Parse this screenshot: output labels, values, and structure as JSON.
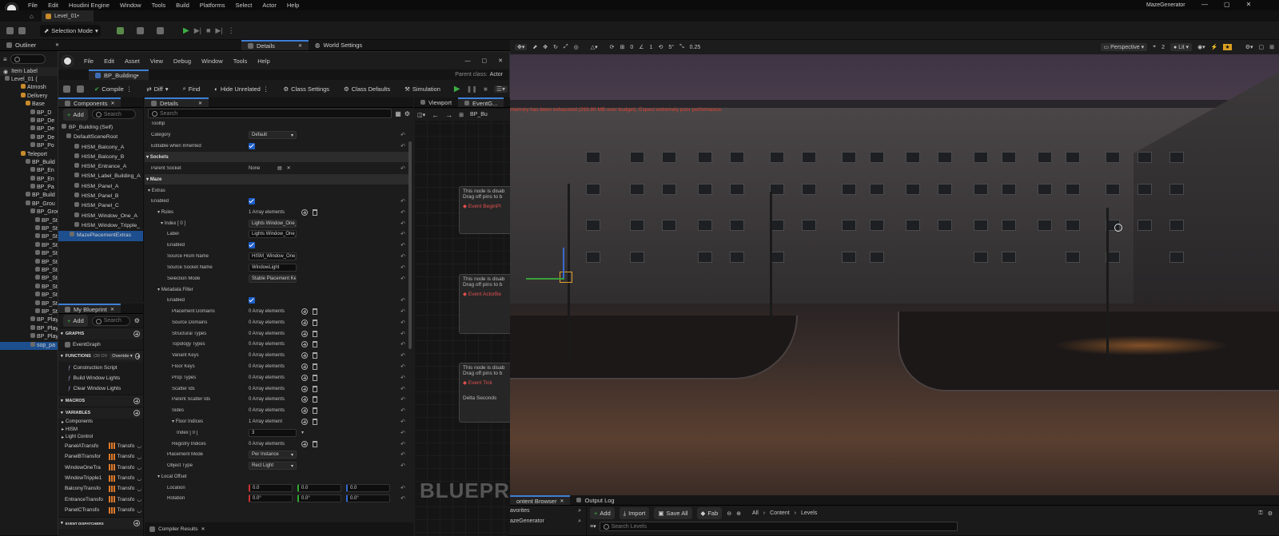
{
  "menubar": {
    "items": [
      "File",
      "Edit",
      "Houdini Engine",
      "Window",
      "Tools",
      "Build",
      "Platforms",
      "Select",
      "Actor",
      "Help"
    ],
    "project": "MazeGenerator"
  },
  "level_tab": "Level_01•",
  "toolbar": {
    "mode": "Selection Mode"
  },
  "left_tabs": {
    "outliner": "Outliner",
    "details": "Details",
    "world_settings": "World Settings"
  },
  "outliner": {
    "column": "Item Label",
    "items": [
      "Level_01 (",
      "Atmosh",
      "Delivery",
      "Base",
      "BP_D",
      "BP_De",
      "BP_De",
      "BP_De",
      "BP_Po",
      "Teleport",
      "BP_Build",
      "BP_En",
      "BP_En",
      "BP_Pa",
      "BP_Build",
      "BP_Grou",
      "BP_Grou",
      "BP_St",
      "BP_St",
      "BP_St",
      "BP_St",
      "BP_St",
      "BP_St",
      "BP_St",
      "BP_St",
      "BP_St",
      "BP_St",
      "BP_St",
      "BP_St",
      "BP_Play",
      "BP_Play",
      "BP_Play",
      "sop_pa"
    ]
  },
  "bp_menu": [
    "File",
    "Edit",
    "Asset",
    "View",
    "Debug",
    "Window",
    "Tools",
    "Help"
  ],
  "bp_tab": "BP_Building•",
  "parent_class_label": "Parent class:",
  "parent_class": "Actor",
  "bp_toolbar": {
    "compile": "Compile",
    "diff": "Diff",
    "find": "Find",
    "hide_unrelated": "Hide Unrelated",
    "class_settings": "Class Settings",
    "class_defaults": "Class Defaults",
    "simulation": "Simulation"
  },
  "components": {
    "tab": "Components",
    "add": "Add",
    "search_placeholder": "Search",
    "items": [
      "BP_Building (Self)",
      "DefaultSceneRoot",
      "HISM_Balcony_A",
      "HISM_Balcony_B",
      "HISM_Entrance_A",
      "HISM_Label_Building_A",
      "HISM_Panel_A",
      "HISM_Panel_B",
      "HISM_Panel_C",
      "HISM_Window_One_A",
      "HISM_Window_Tripple_",
      "MazePlacementExtras"
    ]
  },
  "details": {
    "tab": "Details",
    "search_placeholder": "Search",
    "rows": [
      {
        "t": "lbl",
        "label": "Tooltip",
        "val": ""
      },
      {
        "t": "combo",
        "label": "Category",
        "val": "Default"
      },
      {
        "t": "chk",
        "label": "Editable when Inherited"
      },
      {
        "t": "cat",
        "label": "Sockets"
      },
      {
        "t": "sock",
        "label": "Parent Socket",
        "val": "None"
      },
      {
        "t": "cat",
        "label": "Maze"
      },
      {
        "t": "sub",
        "label": "Extras"
      },
      {
        "t": "chk",
        "label": "Enabled"
      },
      {
        "t": "arr",
        "label": "Rules",
        "val": "1 Array elements"
      },
      {
        "t": "combo",
        "label": "Index [ 0 ]",
        "val": "Lights Window_One_A"
      },
      {
        "t": "txt",
        "label": "Label",
        "val": "Lights Window_One_A"
      },
      {
        "t": "chk",
        "label": "Enabled"
      },
      {
        "t": "txt",
        "label": "Source Hism Name",
        "val": "HISM_Window_One_A"
      },
      {
        "t": "txt",
        "label": "Source Socket Name",
        "val": "WindowLight"
      },
      {
        "t": "combo",
        "label": "Selection Mode",
        "val": "Stable Placement Key"
      },
      {
        "t": "sub",
        "label": "Metadata Filter"
      },
      {
        "t": "chk",
        "label": "Enabled"
      },
      {
        "t": "arr",
        "label": "Placement Domains",
        "val": "0 Array elements"
      },
      {
        "t": "arr",
        "label": "Source Domains",
        "val": "0 Array elements"
      },
      {
        "t": "arr",
        "label": "Structural Types",
        "val": "0 Array elements"
      },
      {
        "t": "arr",
        "label": "Topology Types",
        "val": "0 Array elements"
      },
      {
        "t": "arr",
        "label": "Variant Keys",
        "val": "0 Array elements"
      },
      {
        "t": "arr",
        "label": "Floor Keys",
        "val": "0 Array elements"
      },
      {
        "t": "arr",
        "label": "Prop Types",
        "val": "0 Array elements"
      },
      {
        "t": "arr",
        "label": "Scatter Ids",
        "val": "0 Array elements"
      },
      {
        "t": "arr",
        "label": "Parent Scatter Ids",
        "val": "0 Array elements"
      },
      {
        "t": "arr",
        "label": "Sides",
        "val": "0 Array elements"
      },
      {
        "t": "arr",
        "label": "Floor Indices",
        "val": "1 Array element"
      },
      {
        "t": "num",
        "label": "Index [ 0 ]",
        "val": "3"
      },
      {
        "t": "arr",
        "label": "Registry Indices",
        "val": "0 Array elements"
      },
      {
        "t": "combo",
        "label": "Placement Mode",
        "val": "Per Instance"
      },
      {
        "t": "combo",
        "label": "Object Type",
        "val": "Rect Light"
      },
      {
        "t": "sub",
        "label": "Local Offset"
      },
      {
        "t": "vec",
        "label": "Location",
        "vals": [
          "0.0",
          "0.0",
          "0.0"
        ]
      },
      {
        "t": "vec",
        "label": "Rotation",
        "vals": [
          "0.0°",
          "0.0°",
          "0.0°"
        ]
      }
    ]
  },
  "graph": {
    "viewport_tab": "Viewport",
    "event_tab": "EventG...",
    "bp_crumb": "BP_Bu",
    "watermark": "BLUEPR",
    "disabled_line1": "This node is disab",
    "disabled_line2": "Drag off pins to b",
    "nodes": [
      "Event BeginPl",
      "Event ActorBe",
      "Event Tick"
    ],
    "delta": "Delta Seconds"
  },
  "my_blueprint": {
    "tab": "My Blueprint",
    "add": "Add",
    "search_placeholder": "Search",
    "graphs": "GRAPHS",
    "event_graph": "EventGraph",
    "functions": "FUNCTIONS",
    "functions_count": "(39 OV",
    "override": "Override",
    "function_items": [
      "Construction Script",
      "Build Window Lights",
      "Clear Window Lights"
    ],
    "macros": "MACROS",
    "variables": "VARIABLES",
    "var_groups": [
      "Components",
      "HISM",
      "Light Control"
    ],
    "var_items": [
      "PanelATransfo",
      "PanelBTransfor",
      "WindowOneTra",
      "WindowTripple1",
      "BalconyTransfo",
      "EntranceTransfo",
      "PanelCTransfo"
    ],
    "var_type": "Transfo",
    "event_dispatchers": "EVENT DISPATCHERS",
    "compiler_results": "Compiler Results"
  },
  "viewport": {
    "perspective": "Perspective",
    "lit": "Lit",
    "camera_speed": "2",
    "grid": "0",
    "angle": "1",
    "rot": "5°",
    "scale": "0.25",
    "warning": "memory has been exhausted (293.80 MB over budget). Expect extremely poor performance."
  },
  "content_browser": {
    "tab": "ontent Browser",
    "output_log": "Output Log",
    "favorites": "avorites",
    "project": "azeGenerator",
    "add": "Add",
    "import": "Import",
    "save_all": "Save All",
    "fab": "Fab",
    "path": [
      "All",
      "Content",
      "Levels"
    ],
    "search_placeholder": "Search Levels"
  },
  "colors": {
    "accent": "#3d7fd6",
    "play": "#3cb043"
  }
}
